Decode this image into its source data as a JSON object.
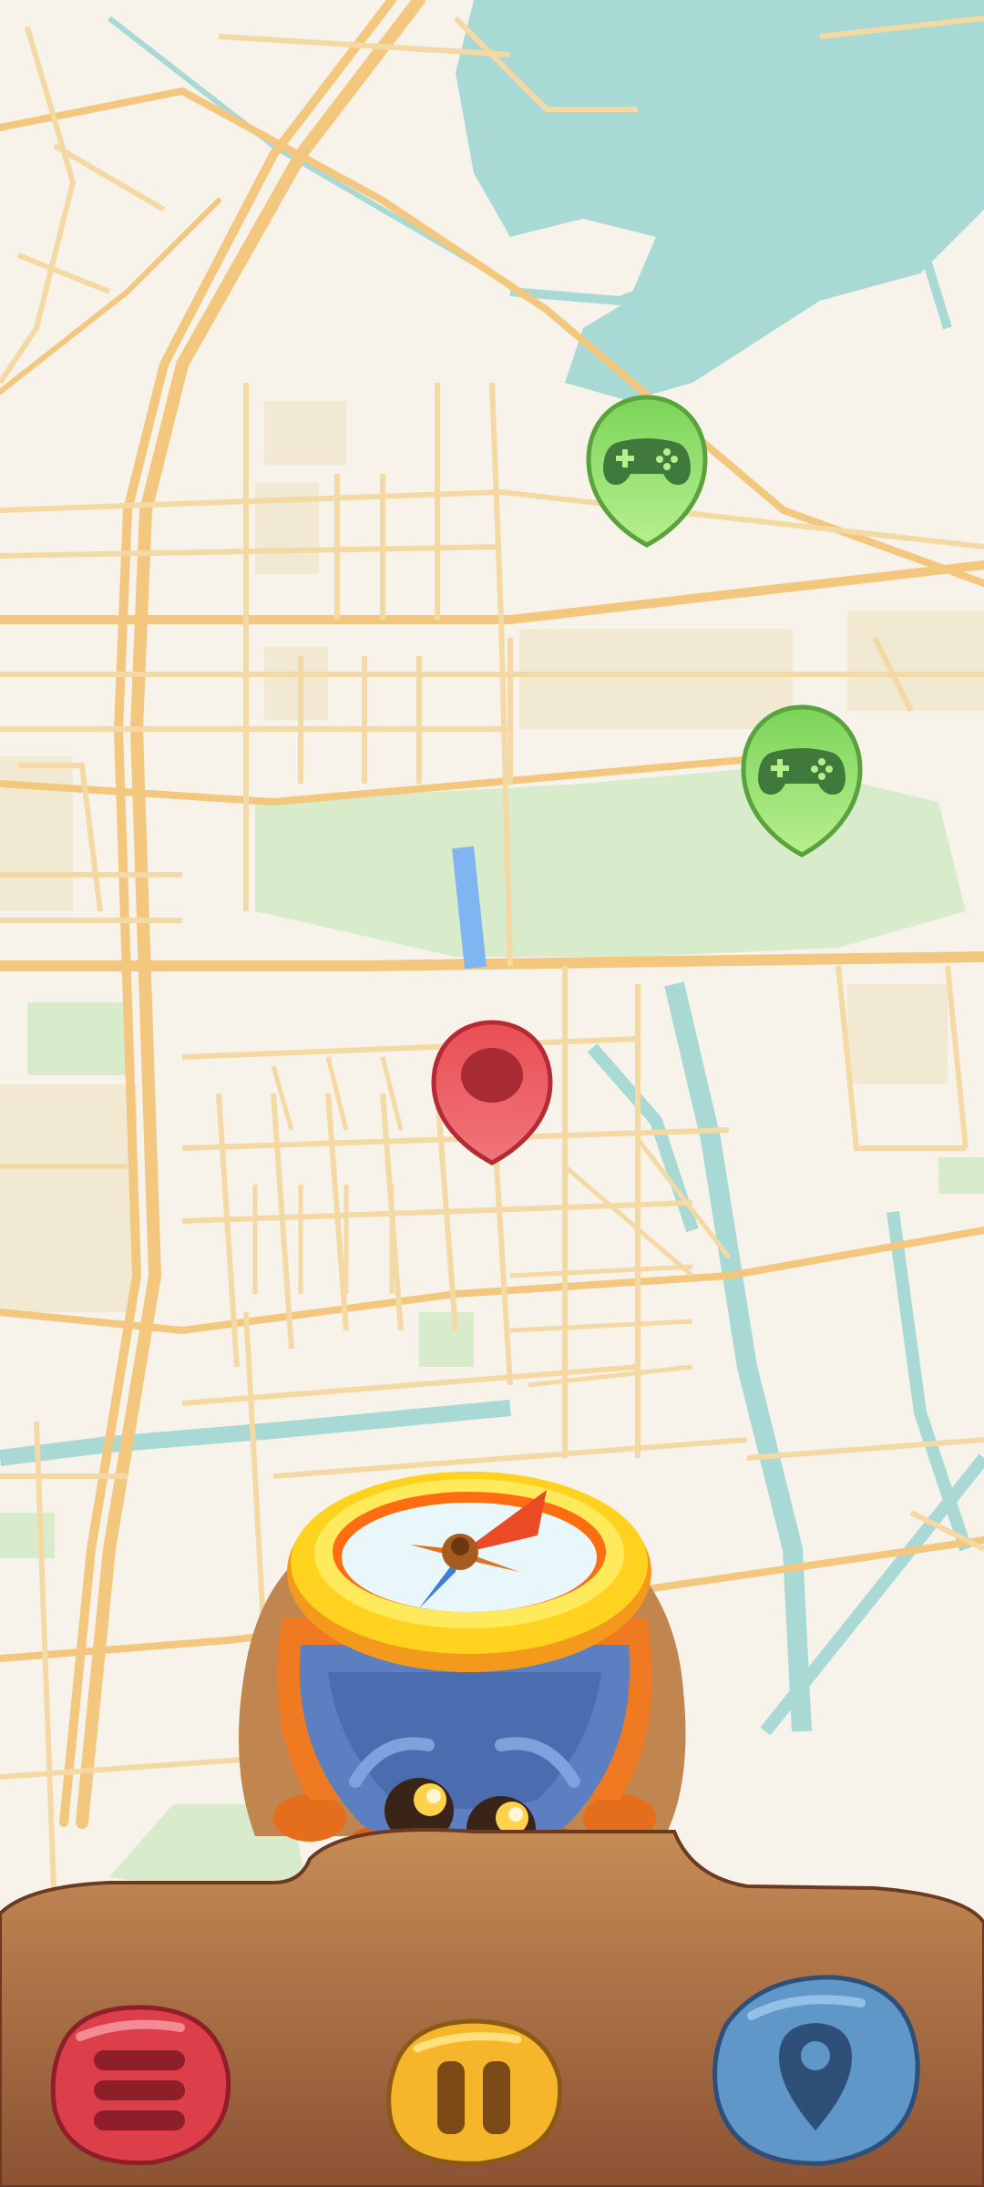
{
  "colors": {
    "map_background": "#f7f3ea",
    "road": "#f4d9a4",
    "major_road": "#f3c77d",
    "water": "#a8d9d4",
    "park": "#d8ebcb",
    "game_pin": "#8fe06a",
    "player_pin": "#e94f55",
    "menu_button": "#d93b45",
    "pause_button": "#f3b52b",
    "location_button": "#5f97c9",
    "bottom_panel": "#b87a49"
  },
  "icons": {
    "game_pin": "gamepad-icon",
    "player_pin": "player-location-pin-icon",
    "menu": "hamburger-menu-icon",
    "pause": "pause-icon",
    "location": "map-pin-icon",
    "mascot": "compass-bug-mascot"
  },
  "map_markers": {
    "game_spots": [
      {
        "id": "game-1",
        "icon": "gamepad-icon"
      },
      {
        "id": "game-2",
        "icon": "gamepad-icon"
      }
    ],
    "player": {
      "icon": "player-location-pin-icon"
    }
  },
  "controls": {
    "menu": {
      "icon": "hamburger-menu-icon"
    },
    "pause": {
      "icon": "pause-icon"
    },
    "location": {
      "icon": "map-pin-icon"
    }
  }
}
